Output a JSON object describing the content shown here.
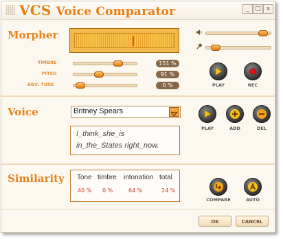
{
  "window": {
    "title_main": "VCS",
    "title_sub": "Voice Comparator",
    "controls": {
      "minimize": "_",
      "maximize": "□",
      "close": "x"
    }
  },
  "morpher": {
    "label": "Morpher",
    "sliders": [
      {
        "name": "TIMBRE",
        "value": "151 %",
        "level": 0.72
      },
      {
        "name": "PITCH",
        "value": "91 %",
        "level": 0.38
      },
      {
        "name": "ADV. TUNE",
        "value": "0 %",
        "level": 0.05
      }
    ],
    "volume_level": 0.92,
    "mic_level": 0.1,
    "meter_level": 0.58,
    "play_label": "PLAY",
    "rec_label": "REC"
  },
  "voice": {
    "label": "Voice",
    "selected": "Britney Spears",
    "text_lines": [
      "I_think_she_is",
      "in_the_States right_now."
    ],
    "play_label": "PLAY",
    "add_label": "ADD",
    "del_label": "DEL"
  },
  "similarity": {
    "label": "Similarity",
    "headers": [
      "Tone",
      "timbre",
      "intonation",
      "total"
    ],
    "values": [
      "40 %",
      "0 %",
      "64 %",
      "24 %"
    ],
    "compare_label": "COMPARE",
    "auto_label": "AUTO"
  },
  "footer": {
    "ok_label": "OK",
    "cancel_label": "CANCEL"
  },
  "colors": {
    "accent": "#e6831a",
    "button_face": "#2b2b2b",
    "value_red": "#d3321a"
  }
}
